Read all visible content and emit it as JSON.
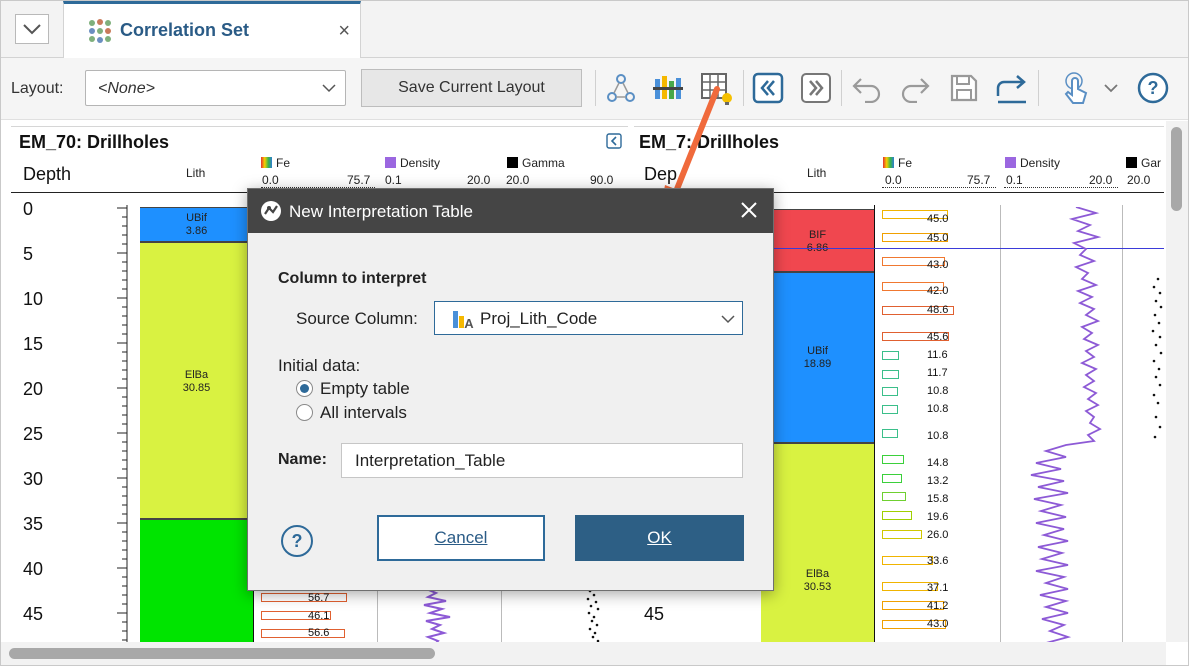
{
  "tab": {
    "title": "Correlation Set",
    "close_glyph": "×"
  },
  "toolbar": {
    "layout_label": "Layout:",
    "layout_value": "<None>",
    "save_layout_label": "Save Current Layout",
    "icons": [
      "network-icon",
      "column-bars-icon",
      "new-table-icon",
      "first-page-icon",
      "last-page-icon",
      "undo-icon",
      "redo-icon",
      "save-icon",
      "export-icon",
      "touch-icon",
      "dropdown-chevron-icon",
      "help-icon"
    ]
  },
  "left_pane": {
    "title": "EM_70: Drillholes",
    "depth_label": "Depth",
    "lith_label": "Lith",
    "fe": {
      "label": "Fe",
      "min": "0.0",
      "max": "75.7"
    },
    "density": {
      "label": "Density",
      "min": "0.1",
      "max": "20.0",
      "color": "#9b67e0"
    },
    "gamma": {
      "label": "Gamma",
      "min": "20.0",
      "max": "90.0",
      "color": "#000000"
    },
    "depth_ticks": [
      "0",
      "5",
      "10",
      "15",
      "20",
      "25",
      "30",
      "35",
      "40",
      "45"
    ],
    "lith_units": [
      {
        "code": "UBif",
        "thickness": "3.86",
        "color": "#1e90ff"
      },
      {
        "code": "ElBa",
        "thickness": "30.85",
        "color": "#d9f241"
      },
      {
        "code": "",
        "thickness": "",
        "color": "#00e400"
      }
    ],
    "fe_values": [
      "56.7",
      "46.1",
      "56.6"
    ]
  },
  "right_pane": {
    "title": "EM_7",
    "title_suffix": ": Drillholes",
    "depth_label": "Dep",
    "lith_label": "Lith",
    "fe": {
      "label": "Fe",
      "min": "0.0",
      "max": "75.7"
    },
    "density": {
      "label": "Density",
      "min": "0.1",
      "max": "20.0"
    },
    "gamma": {
      "label": "Gar",
      "min": "20.0"
    },
    "depth_ticks": [
      "45"
    ],
    "lith_units": [
      {
        "code": "BIF",
        "thickness": "6.86",
        "color": "#f0474f"
      },
      {
        "code": "UBif",
        "thickness": "18.89",
        "color": "#1e90ff"
      },
      {
        "code": "ElBa",
        "thickness": "30.53",
        "color": "#d9f241"
      }
    ],
    "fe_values": [
      "45.0",
      "45.0",
      "43.0",
      "42.0",
      "48.6",
      "45.6",
      "11.6",
      "11.7",
      "10.8",
      "10.8",
      "10.8",
      "14.8",
      "13.2",
      "15.8",
      "19.6",
      "26.0",
      "33.6",
      "37.1",
      "41.2",
      "43.0"
    ]
  },
  "dialog": {
    "title": "New Interpretation Table",
    "close_glyph": "✕",
    "section_heading": "Column to interpret",
    "source_label": "Source Column:",
    "source_value": "Proj_Lith_Code",
    "initial_data_label": "Initial data:",
    "options": [
      {
        "label": "Empty table",
        "selected": true
      },
      {
        "label": "All intervals",
        "selected": false
      }
    ],
    "name_label": "Name:",
    "name_value": "Interpretation_Table",
    "cancel_label": "Cancel",
    "ok_label": "OK",
    "help_glyph": "?"
  },
  "colors": {
    "accent": "#2e6a99",
    "titlebar": "#454545",
    "annotation_arrow": "#f06a3c"
  }
}
